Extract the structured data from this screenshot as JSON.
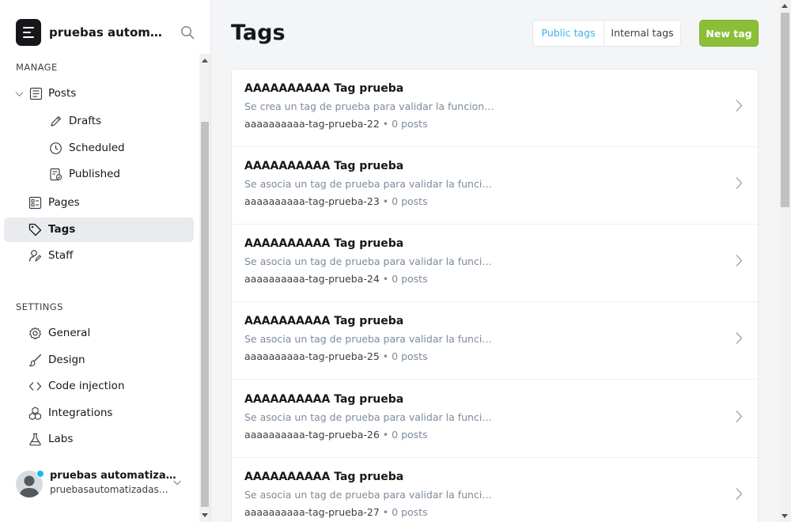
{
  "site": {
    "title": "pruebas automatizadas"
  },
  "sidebar": {
    "manage_title": "MANAGE",
    "settings_title": "SETTINGS",
    "items": {
      "posts": "Posts",
      "drafts": "Drafts",
      "scheduled": "Scheduled",
      "published": "Published",
      "pages": "Pages",
      "tags": "Tags",
      "staff": "Staff",
      "general": "General",
      "design": "Design",
      "code_injection": "Code injection",
      "integrations": "Integrations",
      "labs": "Labs"
    },
    "active_item": "Tags"
  },
  "user": {
    "name": "pruebas automatizadas",
    "email": "pruebasautomatizadas@uniandes.edu.co"
  },
  "header": {
    "title": "Tags",
    "public_tags": "Public tags",
    "internal_tags": "Internal tags",
    "new_tag": "New tag",
    "selected_filter": "Public tags"
  },
  "tags": [
    {
      "name": "AAAAAAAAAA Tag prueba",
      "description": "Se crea un tag de prueba para validar la funcionalidad",
      "slug": "aaaaaaaaaa-tag-prueba-22",
      "count": "0 posts"
    },
    {
      "name": "AAAAAAAAAA Tag prueba",
      "description": "Se asocia un tag de prueba para validar la funcionalidad",
      "slug": "aaaaaaaaaa-tag-prueba-23",
      "count": "0 posts"
    },
    {
      "name": "AAAAAAAAAA Tag prueba",
      "description": "Se asocia un tag de prueba para validar la funcionalidad",
      "slug": "aaaaaaaaaa-tag-prueba-24",
      "count": "0 posts"
    },
    {
      "name": "AAAAAAAAAA Tag prueba",
      "description": "Se asocia un tag de prueba para validar la funcionalidad",
      "slug": "aaaaaaaaaa-tag-prueba-25",
      "count": "0 posts"
    },
    {
      "name": "AAAAAAAAAA Tag prueba",
      "description": "Se asocia un tag de prueba para validar la funcionalidad",
      "slug": "aaaaaaaaaa-tag-prueba-26",
      "count": "0 posts"
    },
    {
      "name": "AAAAAAAAAA Tag prueba",
      "description": "Se asocia un tag de prueba para validar la funcionalidad",
      "slug": "aaaaaaaaaa-tag-prueba-27",
      "count": "0 posts"
    }
  ],
  "meta_separator": " • ",
  "colors": {
    "accent": "#3eb0ef",
    "primary_button": "#8bbf38",
    "badge": "#14b8ff"
  }
}
